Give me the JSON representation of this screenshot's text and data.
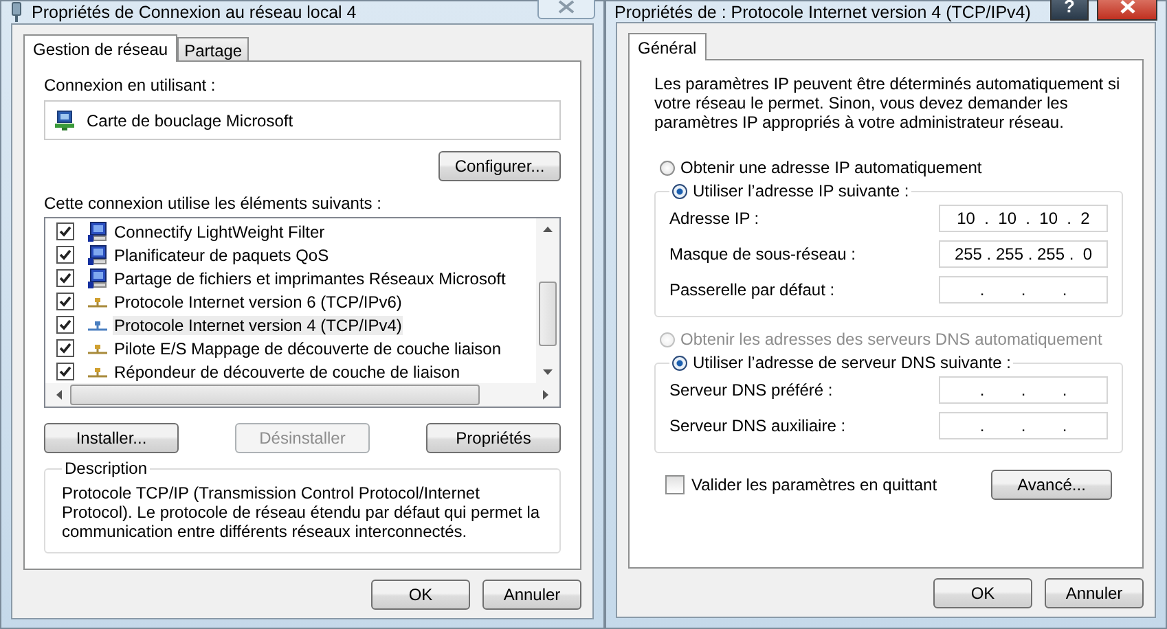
{
  "connection_window": {
    "title": "Propriétés de Connexion au réseau local 4",
    "tabs": [
      {
        "label": "Gestion de réseau",
        "selected": true
      },
      {
        "label": "Partage",
        "selected": false
      }
    ],
    "connect_using_label": "Connexion en utilisant :",
    "adapter": "Carte de bouclage Microsoft",
    "configure_button": "Configurer...",
    "components_label": "Cette connexion utilise les éléments suivants :",
    "components": [
      {
        "label": "Connectify LightWeight Filter",
        "kind": "service",
        "checked": true,
        "selected": false
      },
      {
        "label": "Planificateur de paquets QoS",
        "kind": "service",
        "checked": true,
        "selected": false
      },
      {
        "label": "Partage de fichiers et imprimantes Réseaux Microsoft",
        "kind": "service",
        "checked": true,
        "selected": false
      },
      {
        "label": "Protocole Internet version 6 (TCP/IPv6)",
        "kind": "protocol",
        "checked": true,
        "selected": false
      },
      {
        "label": "Protocole Internet version 4 (TCP/IPv4)",
        "kind": "protocol",
        "checked": true,
        "selected": true
      },
      {
        "label": "Pilote E/S Mappage de découverte de couche liaison",
        "kind": "protocol",
        "checked": true,
        "selected": false
      },
      {
        "label": "Répondeur de découverte de couche de liaison",
        "kind": "protocol",
        "checked": true,
        "selected": false
      }
    ],
    "component_buttons": [
      {
        "label": "Installer...",
        "disabled": false
      },
      {
        "label": "Désinstaller",
        "disabled": true
      },
      {
        "label": "Propriétés",
        "disabled": false
      }
    ],
    "description": {
      "legend": "Description",
      "text": "Protocole TCP/IP (Transmission Control Protocol/Internet Protocol). Le protocole de réseau étendu par défaut qui permet la communication entre différents réseaux interconnectés."
    },
    "dialog_buttons": [
      "OK",
      "Annuler"
    ]
  },
  "ipv4_window": {
    "title": "Propriétés de : Protocole Internet version 4 (TCP/IPv4)",
    "help_button": "?",
    "tabs": [
      {
        "label": "Général",
        "selected": true
      }
    ],
    "intro": "Les paramètres IP peuvent être déterminés automatiquement si votre réseau le permet. Sinon, vous devez demander les paramètres IP appropriés à votre administrateur réseau.",
    "sections": [
      {
        "auto_option": {
          "label": "Obtenir une adresse IP automatiquement",
          "selected": false,
          "disabled": false
        },
        "manual_option": {
          "label": "Utiliser l’adresse IP suivante :",
          "selected": true,
          "disabled": false
        },
        "fields": [
          {
            "label": "Adresse IP :",
            "value": "10  .  10  .  10  .  2"
          },
          {
            "label": "Masque de sous-réseau :",
            "value": "255 . 255 . 255 .  0"
          },
          {
            "label": "Passerelle par défaut :",
            "value": "      .        .        .      "
          }
        ]
      },
      {
        "auto_option": {
          "label": "Obtenir les adresses des serveurs DNS automatiquement",
          "selected": false,
          "disabled": true
        },
        "manual_option": {
          "label": "Utiliser l’adresse de serveur DNS suivante :",
          "selected": true,
          "disabled": false
        },
        "fields": [
          {
            "label": "Serveur DNS préféré :",
            "value": "      .        .        .      "
          },
          {
            "label": "Serveur DNS auxiliaire :",
            "value": "      .        .        .      "
          }
        ]
      }
    ],
    "validate_checkbox": {
      "label": "Valider les paramètres en quittant",
      "checked": false
    },
    "advanced_button": "Avancé...",
    "dialog_buttons": [
      "OK",
      "Annuler"
    ]
  }
}
